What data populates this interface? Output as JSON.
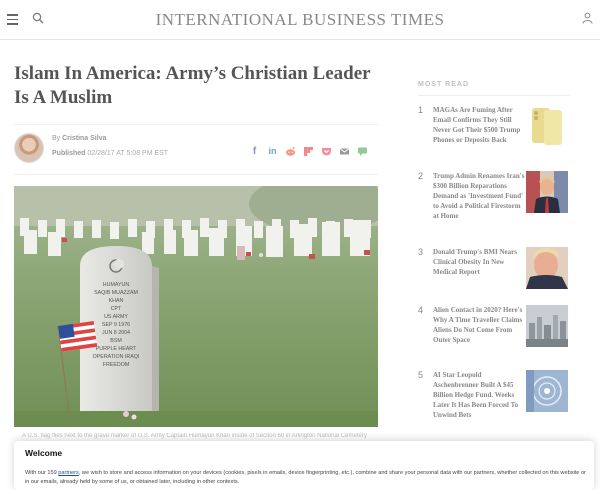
{
  "header": {
    "logo": "INTERNATIONAL BUSINESS TIMES",
    "menu_icon": "hamburger-menu-icon",
    "search_icon": "search-icon",
    "user_icon": "user-icon"
  },
  "article": {
    "title": "Islam In America: Army’s Christian Leader Is A Muslim",
    "byline_prefix": "By",
    "author": "Cristina Silva",
    "published_label": "Published",
    "published_value": "02/28/17 AT 5:08 PM EST",
    "share_icons": [
      "facebook-icon",
      "linkedin-icon",
      "reddit-icon",
      "flipboard-icon",
      "pocket-icon",
      "email-icon",
      "comment-icon"
    ],
    "share_colors": {
      "facebook": "#3b5998",
      "linkedin": "#0077b5",
      "reddit": "#ff4500",
      "flipboard": "#e12828",
      "pocket": "#ef4056",
      "email": "#666666",
      "comment": "#4caf50"
    },
    "photo_headstone_lines": [
      "HUMAYUN",
      "SAQIB MUAZZAM",
      "KHAN",
      "CPT",
      "US ARMY",
      "SEP 9 1976",
      "JUN 8 2004",
      "BSM",
      "PURPLE HEART",
      "OPERATION IRAQI",
      "FREEDOM"
    ],
    "caption": "A U.S. flag flies next to the grave marker of U.S. Army Captain Humayun Khan inside of Section 60 in Arlington National Cemetery"
  },
  "sidebar": {
    "heading": "MOST READ",
    "items": [
      {
        "num": "1",
        "text": "MAGAs Are Fuming After Email Confirms They Still Never Got Their $500 Trump Phones or Deposits Back"
      },
      {
        "num": "2",
        "text": "Trump Admin Renames Iran's $300 Billion Reparations Demand as 'Investment Fund' to Avoid a Political Firestorm at Home"
      },
      {
        "num": "3",
        "text": "Donald Trump's BMI Nears Clinical Obesity In New Medical Report"
      },
      {
        "num": "4",
        "text": "Alien Contact in 2020? Here's Why A Time Traveller Claims Aliens Do Not Come From Outer Space"
      },
      {
        "num": "5",
        "text": "AI Star Leopold Aschenbrenner Built A $45 Billion Hedge Fund. Weeks Later It Has Been Forced To Unwind Bets"
      }
    ]
  },
  "cookie": {
    "title": "Welcome",
    "text_before": "With our 159 ",
    "link": "partners",
    "text_after": ", we wish to store and access information on your devices (cookies, pixels in emails, device fingerprinting, etc.), combine and share your personal data with our partners, whether collected on this website or in our emails, already held by some of us, or obtained later, including in other contexts."
  }
}
